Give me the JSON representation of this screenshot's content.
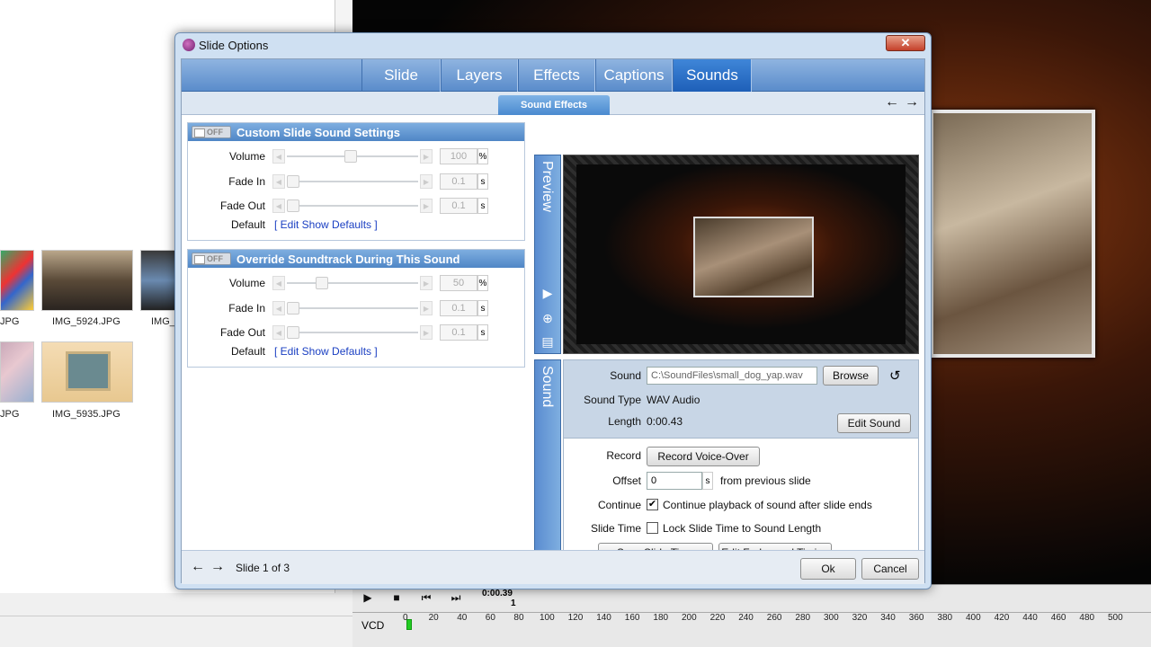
{
  "background": {
    "thumbnails": [
      {
        "label": "JPG"
      },
      {
        "label": "IMG_5924.JPG"
      },
      {
        "label": "IMG_"
      },
      {
        "label": "JPG"
      },
      {
        "label": "IMG_5935.JPG"
      }
    ],
    "timeline": {
      "time": "0:00.39",
      "marker": "1",
      "format": "VCD",
      "ticks": [
        "0",
        "20",
        "40",
        "60",
        "80",
        "100",
        "120",
        "140",
        "160",
        "180",
        "200",
        "220",
        "240",
        "260",
        "280",
        "300",
        "320",
        "340",
        "360",
        "380",
        "400",
        "420",
        "440",
        "460",
        "480",
        "500"
      ]
    }
  },
  "dialog": {
    "title": "Slide Options",
    "close": "✕",
    "tabs": [
      "Slide",
      "Layers",
      "Effects",
      "Captions",
      "Sounds"
    ],
    "active_tab": "Sounds",
    "subtab": "Sound Effects",
    "custom": {
      "toggle": "OFF",
      "title": "Custom Slide Sound Settings",
      "volume_label": "Volume",
      "volume": "100",
      "volume_unit": "%",
      "fadein_label": "Fade In",
      "fadein": "0.1",
      "fadein_unit": "s",
      "fadeout_label": "Fade Out",
      "fadeout": "0.1",
      "fadeout_unit": "s",
      "default_label": "Default",
      "default_link": "[ Edit Show Defaults ]"
    },
    "override": {
      "toggle": "OFF",
      "title": "Override Soundtrack During This Sound",
      "volume_label": "Volume",
      "volume": "50",
      "volume_unit": "%",
      "fadein_label": "Fade In",
      "fadein": "0.1",
      "fadein_unit": "s",
      "fadeout_label": "Fade Out",
      "fadeout": "0.1",
      "fadeout_unit": "s",
      "default_label": "Default",
      "default_link": "[ Edit Show Defaults ]"
    },
    "preview_label": "Preview",
    "sound_label": "Sound",
    "sound": {
      "sound_label": "Sound",
      "sound_path": "C:\\SoundFiles\\small_dog_yap.wav",
      "browse": "Browse",
      "type_label": "Sound Type",
      "type_value": "WAV Audio",
      "length_label": "Length",
      "length_value": "0:00.43",
      "edit_sound": "Edit Sound",
      "record_label": "Record",
      "record_button": "Record Voice-Over",
      "offset_label": "Offset",
      "offset_value": "0",
      "offset_unit": "s",
      "offset_suffix": "from previous slide",
      "continue_label": "Continue",
      "continue_text": "Continue playback of sound after slide ends",
      "continue_checked": true,
      "slidetime_label": "Slide Time",
      "slidetime_text": "Lock Slide Time to Sound Length",
      "slidetime_checked": false,
      "sync_button": "Sync Slide Time",
      "fades_button": "Edit Fades and Timing"
    },
    "footer": {
      "slide_counter": "Slide 1 of 3",
      "ok": "Ok",
      "cancel": "Cancel"
    }
  }
}
